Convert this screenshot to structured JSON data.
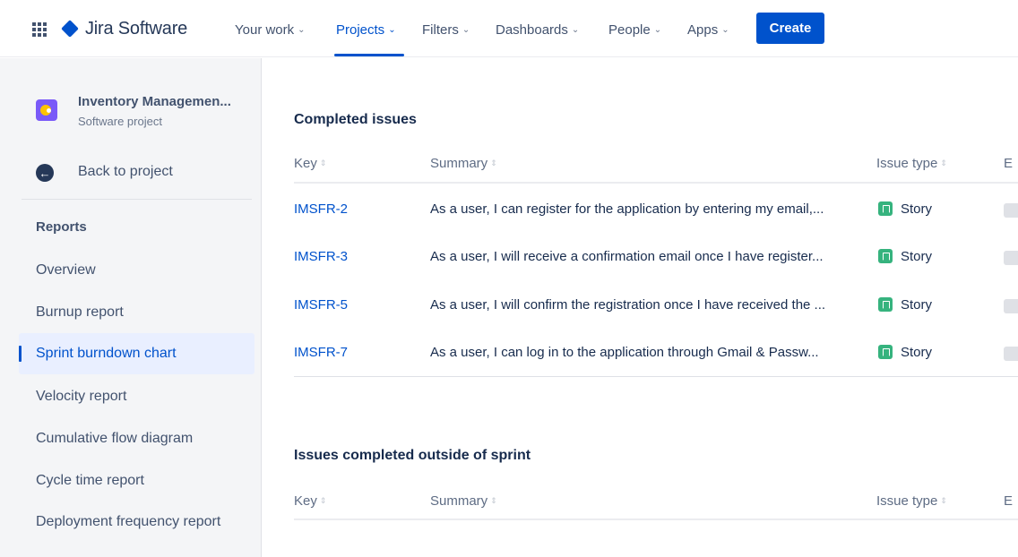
{
  "topnav": {
    "product_name": "Jira Software",
    "items": [
      {
        "label": "Your work",
        "chevron": "⌄"
      },
      {
        "label": "Projects",
        "chevron": "⌄"
      },
      {
        "label": "Filters",
        "chevron": "⌄"
      },
      {
        "label": "Dashboards",
        "chevron": "⌄"
      },
      {
        "label": "People",
        "chevron": "⌄"
      },
      {
        "label": "Apps",
        "chevron": "⌄"
      }
    ],
    "active_item": "Projects",
    "create_label": "Create",
    "accent_color": "#0052cc"
  },
  "sidebar": {
    "project_name": "Inventory Managemen...",
    "project_type": "Software project",
    "back_label": "Back to project",
    "section_heading": "Reports",
    "items": [
      {
        "label": "Overview"
      },
      {
        "label": "Burnup report"
      },
      {
        "label": "Sprint burndown chart"
      },
      {
        "label": "Velocity report"
      },
      {
        "label": "Cumulative flow diagram"
      },
      {
        "label": "Cycle time report"
      },
      {
        "label": "Deployment frequency report"
      }
    ],
    "active_item": "Sprint burndown chart"
  },
  "completed": {
    "title": "Completed issues",
    "columns": {
      "key": "Key",
      "summary": "Summary",
      "issue_type": "Issue type",
      "epic": "E"
    },
    "rows": [
      {
        "key": "IMSFR-2",
        "summary": "As a user, I can register for the application by entering my email,...",
        "type": "Story",
        "type_icon": "story-icon"
      },
      {
        "key": "IMSFR-3",
        "summary": "As a user, I will receive a confirmation email once I have register...",
        "type": "Story",
        "type_icon": "story-icon"
      },
      {
        "key": "IMSFR-5",
        "summary": "As a user, I will confirm the registration once I have received the ...",
        "type": "Story",
        "type_icon": "story-icon"
      },
      {
        "key": "IMSFR-7",
        "summary": "As a user, I can log in to the application through Gmail & Passw...",
        "type": "Story",
        "type_icon": "story-icon"
      }
    ]
  },
  "outside_sprint": {
    "title": "Issues completed outside of sprint",
    "columns": {
      "key": "Key",
      "summary": "Summary",
      "issue_type": "Issue type",
      "epic": "E"
    }
  },
  "sort_glyph": "⇕",
  "colors": {
    "story": "#36b37e",
    "sidebar_bg": "#f4f5f7",
    "active_bg": "#e9efff"
  }
}
